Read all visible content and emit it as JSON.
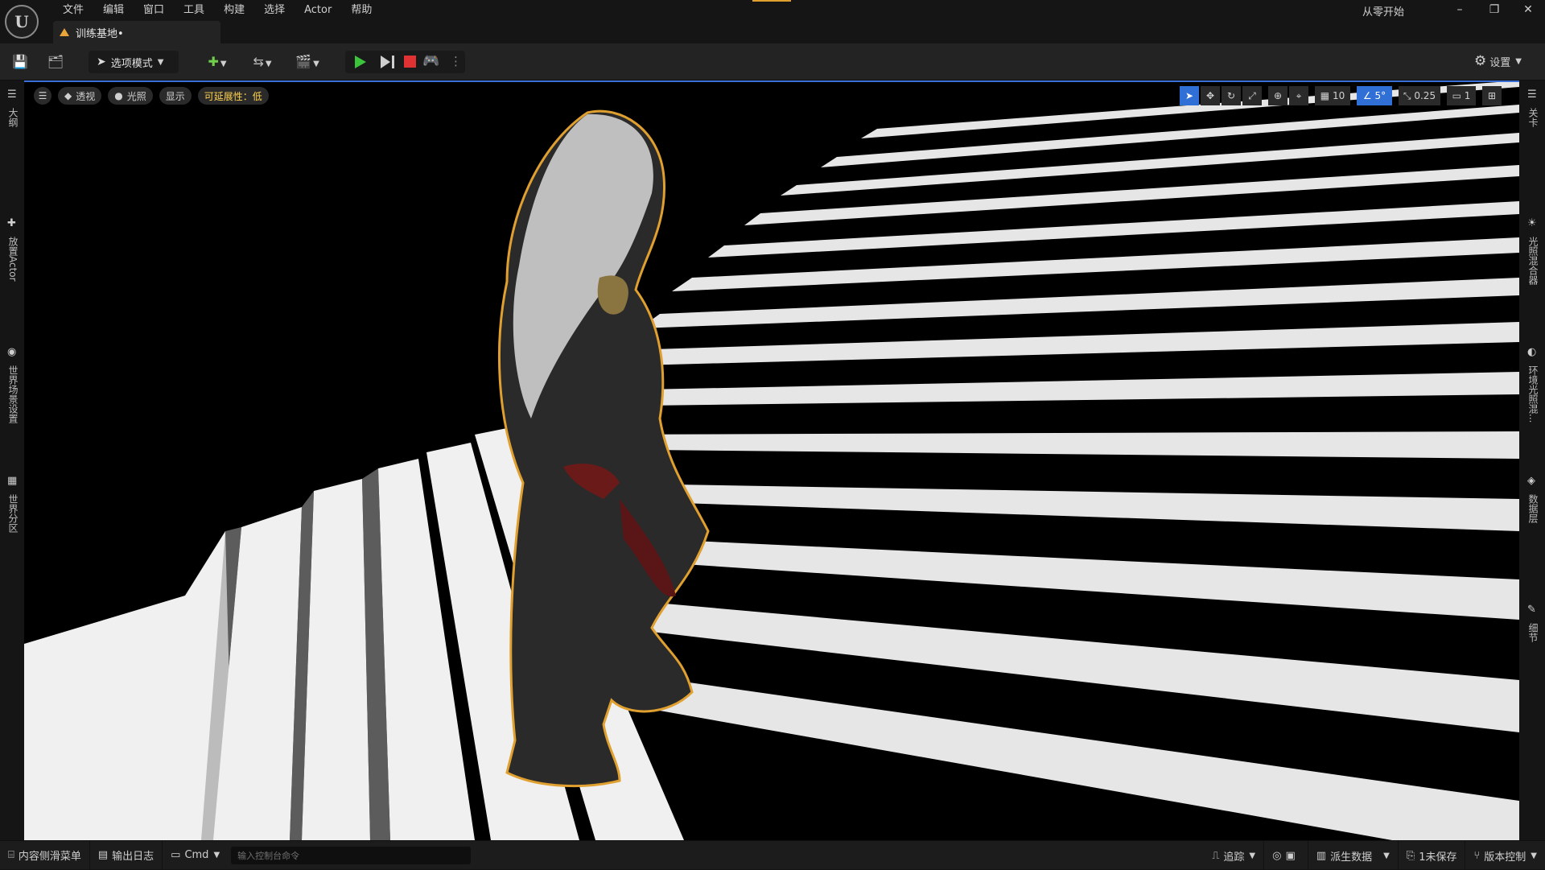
{
  "app": {
    "logo_text": "U",
    "menu": [
      "文件",
      "编辑",
      "窗口",
      "工具",
      "构建",
      "选择",
      "Actor",
      "帮助"
    ],
    "tab_title": "训练基地•",
    "top_right_label": "从零开始",
    "window_controls": [
      "minimize-icon",
      "restore-icon",
      "close-icon"
    ]
  },
  "toolbar": {
    "save_icon": "💾",
    "browse_icon": "🗂",
    "mode_label": "选项模式",
    "add_icon": "✚",
    "blueprint_icon": "⇆",
    "cinematic_icon": "🎬",
    "settings_label": "设置"
  },
  "viewport": {
    "menu_icon": "☰",
    "perspective_label": "透视",
    "lighting_label": "光照",
    "show_label": "显示",
    "scalability_label": "可延展性：低",
    "grid_snap": "10",
    "rotate_snap": "5°",
    "scale_snap": "0.25",
    "camera_speed": "1"
  },
  "left_panel": {
    "outliner": "大纲",
    "place_actors": "放置Actor",
    "world_settings": "世界场景设置",
    "world_partition": "世界分区"
  },
  "right_panel": {
    "levels": "关卡",
    "light_mixer": "光照混合器",
    "env_light_mixer": "环境光照混...",
    "data_layers": "数据层",
    "details": "细节"
  },
  "statusbar": {
    "content_drawer": "内容侧滑菜单",
    "output_log": "输出日志",
    "cmd": "Cmd",
    "console_placeholder": "输入控制台命令",
    "trace": "追踪",
    "derived_data": "派生数据",
    "unsaved": "1未保存",
    "source_control": "版本控制"
  },
  "colors": {
    "accent_blue": "#2f6fd6",
    "play_green": "#3dc43d",
    "stop_red": "#e03232",
    "warning_yellow": "#ffd24d",
    "selection_orange": "#e0a030"
  }
}
